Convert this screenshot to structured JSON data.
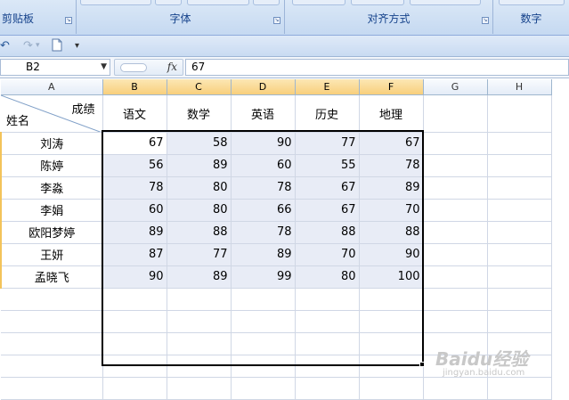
{
  "ribbon": {
    "groups": [
      "剪贴板",
      "字体",
      "对齐方式",
      "数字"
    ]
  },
  "quick_access": {
    "undo_icon": "undo-arrow",
    "redo_icon": "redo-arrow",
    "new_icon": "new-document",
    "customize_icon": "dropdown-arrow"
  },
  "formula_bar": {
    "name_box": "B2",
    "fx_label": "fx",
    "content": "67"
  },
  "sheet": {
    "columns": [
      "A",
      "B",
      "C",
      "D",
      "E",
      "F",
      "G",
      "H"
    ],
    "selected_columns": [
      "B",
      "C",
      "D",
      "E",
      "F"
    ],
    "header_row": {
      "diag_top_right": "成绩",
      "diag_bottom_left": "姓名",
      "subjects": [
        "语文",
        "数学",
        "英语",
        "历史",
        "地理"
      ]
    },
    "rows": [
      {
        "name": "刘涛",
        "scores": [
          "67",
          "58",
          "90",
          "77",
          "67"
        ]
      },
      {
        "name": "陈婷",
        "scores": [
          "56",
          "89",
          "60",
          "55",
          "78"
        ]
      },
      {
        "name": "李淼",
        "scores": [
          "78",
          "80",
          "78",
          "67",
          "89"
        ]
      },
      {
        "name": "李娟",
        "scores": [
          "60",
          "80",
          "66",
          "67",
          "70"
        ]
      },
      {
        "name": "欧阳梦婷",
        "scores": [
          "89",
          "88",
          "78",
          "88",
          "88"
        ]
      },
      {
        "name": "王妍",
        "scores": [
          "87",
          "77",
          "89",
          "70",
          "90"
        ]
      },
      {
        "name": "孟晓飞",
        "scores": [
          "90",
          "89",
          "99",
          "80",
          "100"
        ]
      }
    ],
    "empty_rows": 5,
    "colors": {
      "selection_fill": "#e8ecf6",
      "selected_header": "#f8cf7c",
      "grid_line": "#d0d7e5"
    }
  },
  "watermark": {
    "brand": "Baidu经验",
    "url": "jingyan.baidu.com"
  }
}
